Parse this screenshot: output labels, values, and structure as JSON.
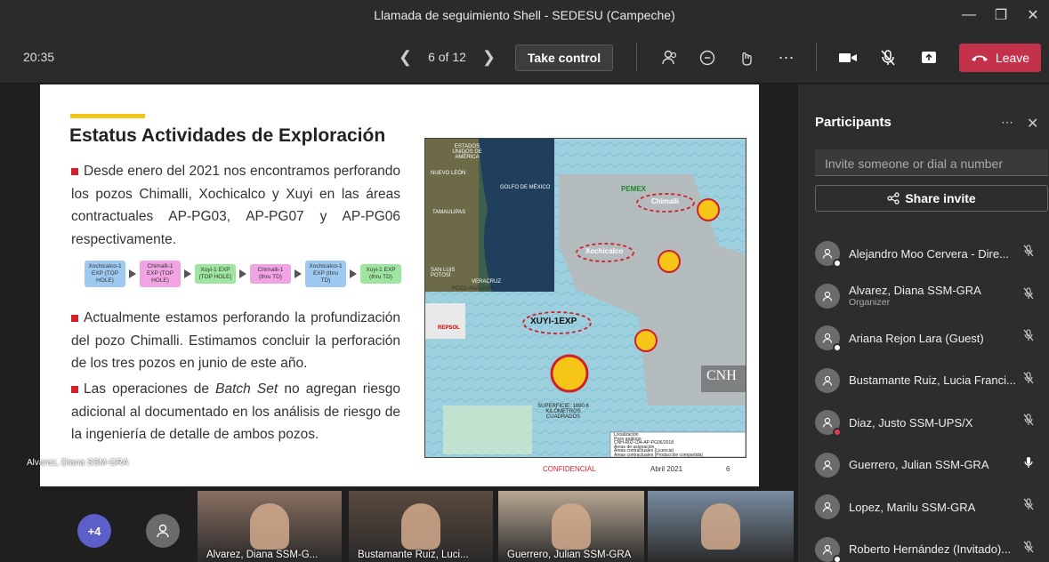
{
  "window": {
    "title": "Llamada de seguimiento Shell - SEDESU (Campeche)"
  },
  "toolbar": {
    "clock": "20:35",
    "pager": "6 of 12",
    "take_control": "Take control",
    "leave": "Leave"
  },
  "slide": {
    "title": "Estatus Actividades de Exploración",
    "bullet1": "Desde enero del 2021 nos encontramos perforando los pozos Chimalli, Xochicalco y Xuyi en las áreas contractuales AP-PG03, AP-PG07 y AP-PG06 respectivamente.",
    "bullet2": "Actualmente estamos perforando la profundización del pozo Chimalli. Estimamos concluir la perforación de los tres pozos en junio de este año.",
    "bullet3_pre": "Las operaciones de ",
    "bullet3_em": "Batch Set",
    "bullet3_post": " no agregan riesgo adicional al documentado en los análisis de riesgo de la ingeniería de detalle de ambos pozos.",
    "flow": [
      {
        "label": "Xochicalco-1 EXP (TOP HOLE)",
        "color": "#9ec9f0"
      },
      {
        "label": "Chimalli-1 EXP (TOP HOLE)",
        "color": "#f2a3e3"
      },
      {
        "label": "Xuyi-1 EXP (TOP HOLE)",
        "color": "#9ee6a0"
      },
      {
        "label": "Chimalli-1 (thru TD)",
        "color": "#f2a3e3"
      },
      {
        "label": "Xochicalco-1 EXP (thru TD)",
        "color": "#9ec9f0"
      },
      {
        "label": "Xuyi-1 EXP (thru TD)",
        "color": "#9ee6a0"
      }
    ],
    "map": {
      "states": "ESTADOS UNIDOS DE AMÉRICA",
      "nuevo_leon": "NUEVO LEÓN",
      "golfo": "GOLFO DE MÉXICO",
      "tamaulipas": "TAMAULIPAS",
      "san_luis": "SAN LUIS POTOSÍ",
      "veracruz": "VERACRUZ",
      "pozo": "POZO ANÁLOGO",
      "chimalli": "Chimalli",
      "xochicalco": "Xochicalco",
      "xuyi": "XUYI-1EXP",
      "pemex": "PEMEX",
      "repsol": "REPSOL",
      "cnh": "CNH",
      "superficie": "SUPERFICIE: 1890.6 KILÓMETROS CUADRADOS",
      "legend": [
        "Localización",
        "Pozo análogo",
        "CNH-R02-L04-AP-PG06/2018",
        "Áreas de asignación",
        "Áreas contractuales (Licencia)",
        "Áreas contractuales (Producción compartida)"
      ]
    },
    "confidencial": "CONFIDENCIAL",
    "date": "Abril 2021",
    "page": "6",
    "speaker_tag": "Alvarez, Diana SSM-GRA"
  },
  "strip": {
    "more_count": "+4",
    "tiles": [
      {
        "name": "Alvarez, Diana SSM-G...",
        "color": "#8a6f62"
      },
      {
        "name": "Bustamante Ruiz, Luci...",
        "color": "#5a4a3e"
      },
      {
        "name": "Guerrero, Julian SSM-GRA",
        "color": "#b9a894"
      },
      {
        "name": "",
        "color": "#7a8ca0"
      }
    ]
  },
  "panel": {
    "title": "Participants",
    "invite_placeholder": "Invite someone or dial a number",
    "share_invite": "Share invite",
    "participants": [
      {
        "name": "Alejandro Moo Cervera - Dire...",
        "sub": "",
        "status": "#ffffff",
        "mic": "muted"
      },
      {
        "name": "Alvarez, Diana SSM-GRA",
        "sub": "Organizer",
        "status": "",
        "mic": "muted"
      },
      {
        "name": "Ariana Rejon Lara (Guest)",
        "sub": "",
        "status": "#ffffff",
        "mic": "muted"
      },
      {
        "name": "Bustamante Ruiz, Lucia Franci...",
        "sub": "",
        "status": "",
        "mic": "muted"
      },
      {
        "name": "Diaz, Justo SSM-UPS/X",
        "sub": "",
        "status": "#e23b4b",
        "mic": "muted"
      },
      {
        "name": "Guerrero, Julian SSM-GRA",
        "sub": "",
        "status": "",
        "mic": "on"
      },
      {
        "name": "Lopez, Marilu SSM-GRA",
        "sub": "",
        "status": "",
        "mic": "muted"
      },
      {
        "name": "Roberto Hernández (Invitado)...",
        "sub": "",
        "status": "#ffffff",
        "mic": "muted"
      }
    ]
  }
}
